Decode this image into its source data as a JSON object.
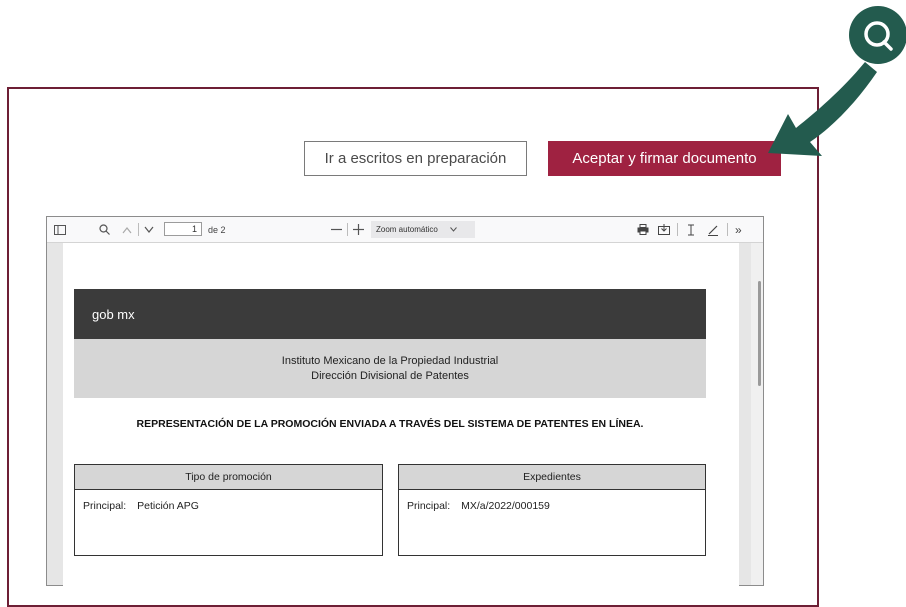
{
  "actions": {
    "secondary_label": "Ir a escritos en preparación",
    "primary_label": "Aceptar y firmar documento"
  },
  "viewer": {
    "page_current": "1",
    "page_total": "de 2",
    "zoom_label": "Zoom automático"
  },
  "document": {
    "logo_text": "gob mx",
    "institute": "Instituto Mexicano de la Propiedad Industrial",
    "division": "Dirección Divisional de Patentes",
    "title": "REPRESENTACIÓN DE LA PROMOCIÓN ENVIADA A TRAVÉS DEL SISTEMA DE PATENTES EN LÍNEA.",
    "left_table": {
      "header": "Tipo de promoción",
      "label": "Principal:",
      "value": "Petición APG"
    },
    "right_table": {
      "header": "Expedientes",
      "label": "Principal:",
      "value": "MX/a/2022/000159"
    }
  },
  "colors": {
    "accent": "#9f2241",
    "frame": "#6d1f35",
    "annotation": "#235b4e"
  },
  "annotation": {
    "icon": "search-icon",
    "arrow": "arrow-icon"
  }
}
